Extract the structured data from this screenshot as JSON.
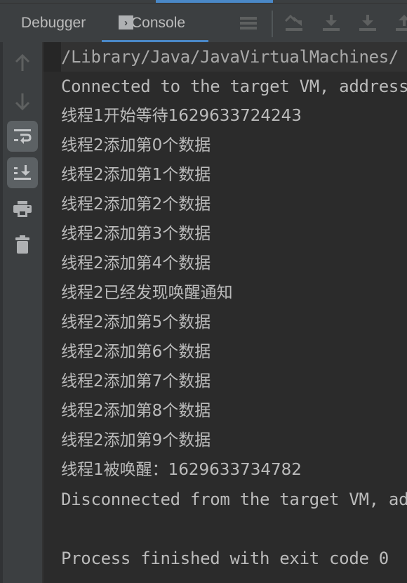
{
  "tabs": {
    "debugger_label": "Debugger",
    "console_label": "Console",
    "active": "Console"
  },
  "toolbar": {
    "icons": [
      "threads-list-icon",
      "show-execution-point-icon",
      "step-over-icon",
      "step-into-icon",
      "step-out-icon"
    ]
  },
  "gutter": {
    "icons": [
      "up-arrow-icon",
      "down-arrow-icon",
      "soft-wrap-icon",
      "scroll-to-end-icon",
      "print-icon",
      "clear-all-icon"
    ]
  },
  "console": {
    "lines": [
      "/Library/Java/JavaVirtualMachines/",
      "Connected to the target VM, address",
      "线程1开始等待1629633724243",
      "线程2添加第0个数据",
      "线程2添加第1个数据",
      "线程2添加第2个数据",
      "线程2添加第3个数据",
      "线程2添加第4个数据",
      "线程2已经发现唤醒通知",
      "线程2添加第5个数据",
      "线程2添加第6个数据",
      "线程2添加第7个数据",
      "线程2添加第8个数据",
      "线程2添加第9个数据",
      "线程1被唤醒：1629633734782",
      "Disconnected from the target VM, address",
      "",
      "Process finished with exit code 0"
    ]
  },
  "colors": {
    "accent": "#4a88c7",
    "panel": "#3c3f41",
    "console_bg": "#2b2b2b",
    "text": "#bbbbbb"
  }
}
